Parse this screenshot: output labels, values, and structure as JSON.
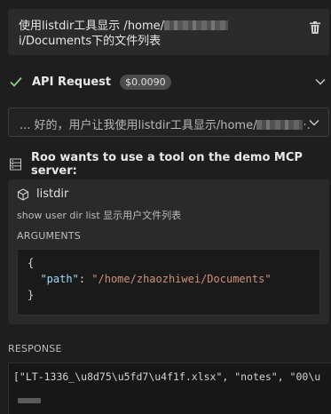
{
  "task": {
    "text_before": "使用listdir工具显示 /home/",
    "text_after": "i/Documents下的文件列表",
    "delete_icon": "trash-icon"
  },
  "api_request": {
    "status_icon": "check-icon",
    "label": "API Request",
    "cost": "$0.0090",
    "expand_icon": "chevron-down-icon"
  },
  "reasoning": {
    "text_before": "... 好的，用户让我使用listdir工具显示/home/",
    "text_after": "·.",
    "expand_icon": "chevron-down-icon"
  },
  "mcp": {
    "header_icon": "server-icon",
    "title": "Roo wants to use a tool on the demo MCP server:",
    "tool_icon": "cube-icon",
    "tool_name": "listdir",
    "tool_description": "show user dir list 显示用户文件列表",
    "arguments_label": "ARGUMENTS",
    "arguments_code": {
      "open": "{",
      "key": "\"path\"",
      "colon": ": ",
      "value": "\"/home/zhaozhiwei/Documents\"",
      "close": "}"
    },
    "response_label": "RESPONSE",
    "response_text": "[\"LT-1336_\\u8d75\\u5fd7\\u4f1f.xlsx\", \"notes\", \"00\\u"
  },
  "colors": {
    "background": "#1e1e1e",
    "success": "#89d185",
    "json_key": "#9cdcfe",
    "json_string": "#ce9178"
  }
}
